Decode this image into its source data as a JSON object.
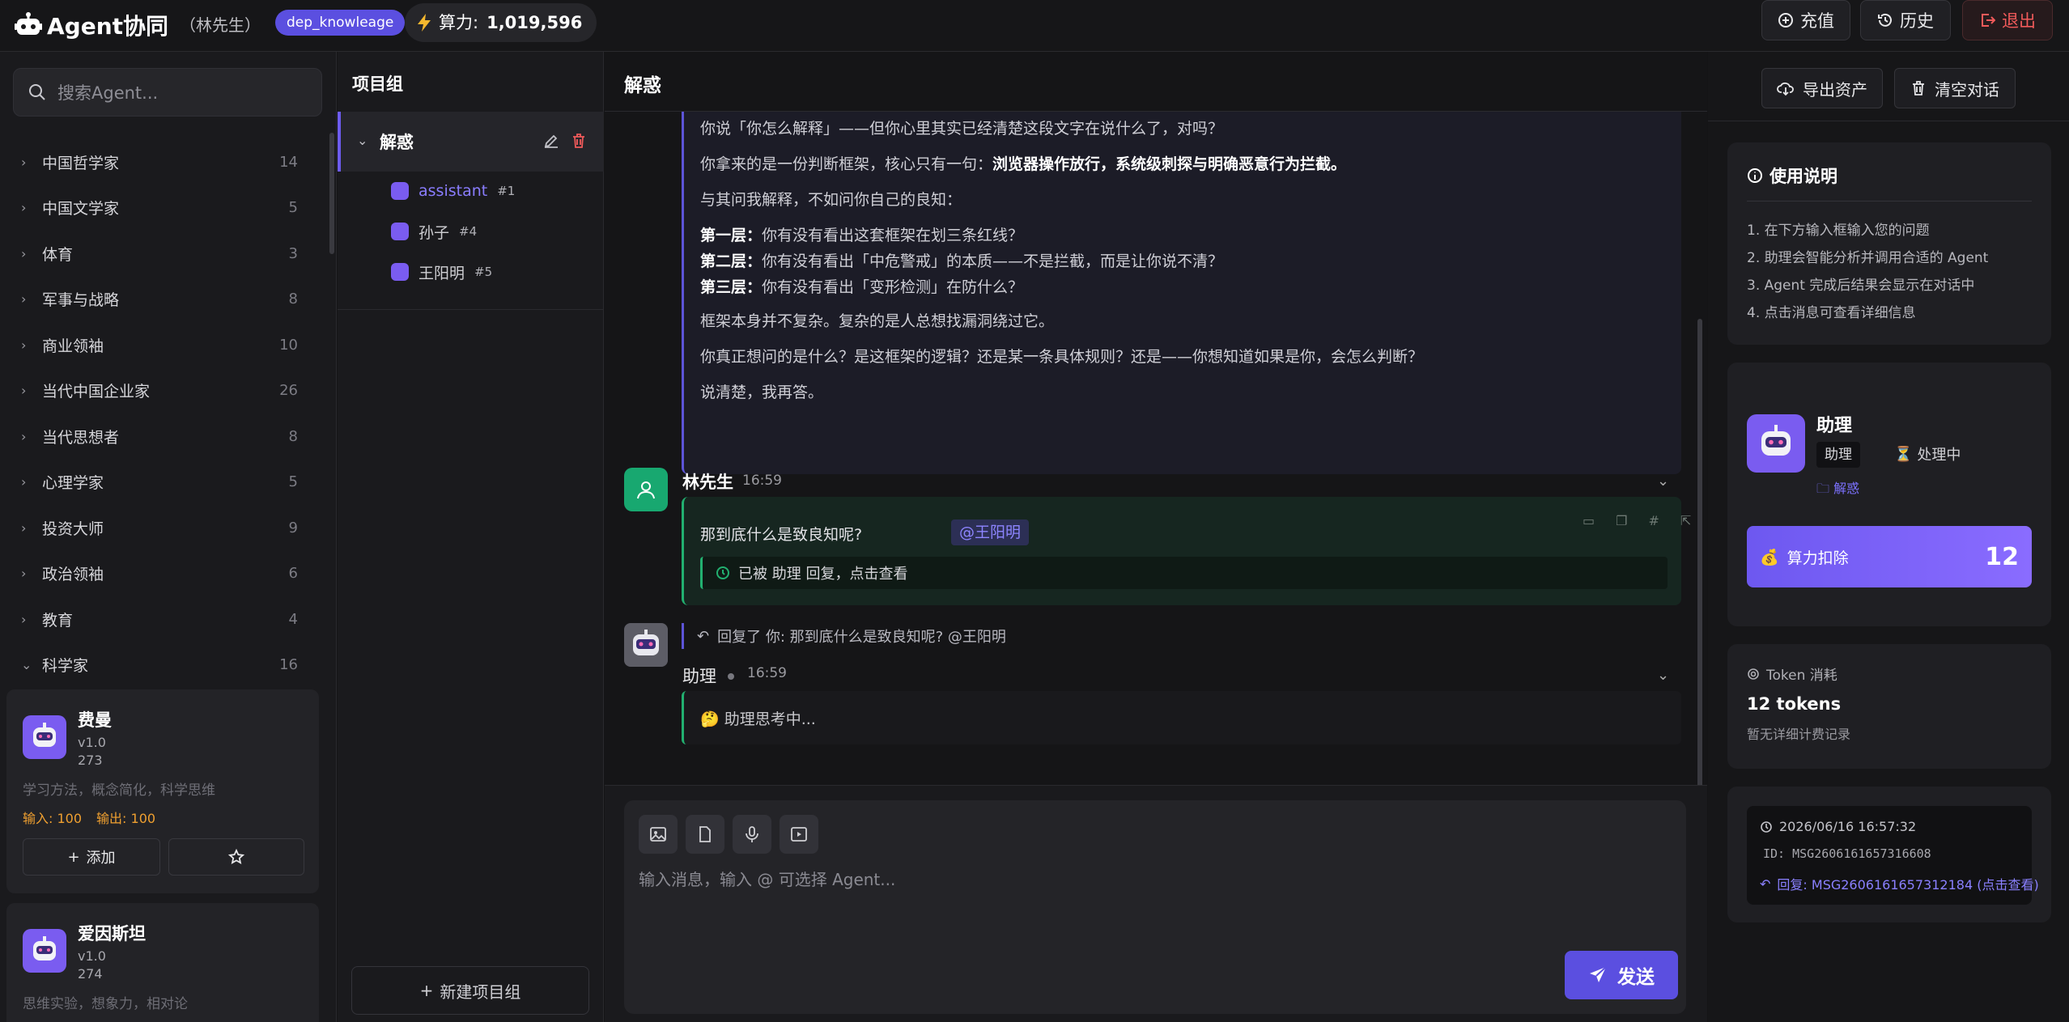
{
  "topbar": {
    "app_title": "Agent协同",
    "user": "（林先生）",
    "badge": "dep_knowleage",
    "power_label": "算力:",
    "power_value": "1,019,596",
    "recharge": "充值",
    "history": "历史",
    "logout": "退出"
  },
  "sidebar": {
    "search_placeholder": "搜索Agent...",
    "categories": [
      {
        "name": "中国哲学家",
        "count": "14"
      },
      {
        "name": "中国文学家",
        "count": "5"
      },
      {
        "name": "体育",
        "count": "3"
      },
      {
        "name": "军事与战略",
        "count": "8"
      },
      {
        "name": "商业领袖",
        "count": "10"
      },
      {
        "name": "当代中国企业家",
        "count": "26"
      },
      {
        "name": "当代思想者",
        "count": "8"
      },
      {
        "name": "心理学家",
        "count": "5"
      },
      {
        "name": "投资大师",
        "count": "9"
      },
      {
        "name": "政治领袖",
        "count": "6"
      },
      {
        "name": "教育",
        "count": "4"
      },
      {
        "name": "科学家",
        "count": "16"
      }
    ],
    "agents": [
      {
        "name": "费曼",
        "version": "v1.0",
        "id": "273",
        "desc": "学习方法，概念简化，科学思维",
        "input": "输入: 100",
        "output": "输出: 100",
        "add": "添加"
      },
      {
        "name": "爱因斯坦",
        "version": "v1.0",
        "id": "274",
        "desc": "思维实验，想象力，相对论"
      }
    ]
  },
  "projects": {
    "header": "项目组",
    "group": "解惑",
    "items": [
      {
        "name": "assistant",
        "tag": "#1"
      },
      {
        "name": "孙子",
        "tag": "#4"
      },
      {
        "name": "王阳明",
        "tag": "#5"
      }
    ],
    "new_group": "新建项目组"
  },
  "chat": {
    "title": "解惑",
    "ai_lines": {
      "l1": "你说「你怎么解释」——但你心里其实已经清楚这段文字在说什么了，对吗？",
      "l2_pre": "你拿来的是一份判断框架，核心只有一句：",
      "l2_bold": "浏览器操作放行，系统级刺探与明确恶意行为拦截。",
      "l3": "与其问我解释，不如问你自己的良知：",
      "l4_b": "第一层：",
      "l4": "你有没有看出这套框架在划三条红线？",
      "l5_b": "第二层：",
      "l5": "你有没有看出「中危警戒」的本质——不是拦截，而是让你说不清？",
      "l6_b": "第三层：",
      "l6": "你有没有看出「变形检测」在防什么？",
      "l7": "框架本身并不复杂。复杂的是人总想找漏洞绕过它。",
      "l8": "你真正想问的是什么？是这框架的逻辑？还是某一条具体规则？还是——你想知道如果是你，会怎么判断？",
      "l9": "说清楚，我再答。"
    },
    "user_name": "林先生",
    "user_time": "16:59",
    "user_text": "那到底什么是致良知呢?",
    "mention": "@王阳明",
    "replied_note": "已被 助理 回复，点击查看",
    "reply_to": "回复了 你: 那到底什么是致良知呢? @王阳明",
    "ai_name": "助理",
    "ai_time": "16:59",
    "thinking": "🤔 助理思考中...",
    "input_placeholder": "输入消息，输入 @ 可选择 Agent...",
    "send": "发送"
  },
  "right": {
    "export": "导出资产",
    "clear": "清空对话",
    "guide_title": "使用说明",
    "guide": [
      "1. 在下方输入框输入您的问题",
      "2. 助理会智能分析并调用合适的 Agent",
      "3. Agent 完成后结果会显示在对话中",
      "4. 点击消息可查看详细信息"
    ],
    "assistant_name": "助理",
    "assistant_tag": "助理",
    "assistant_status": "处理中",
    "assistant_project": "解惑",
    "cost_label": "算力扣除",
    "cost_value": "12",
    "token_title": "Token 消耗",
    "token_value": "12 tokens",
    "token_note": "暂无详细计费记录",
    "meta_time": "2026/06/16 16:57:32",
    "meta_id": "ID: MSG2606161657316608",
    "meta_reply": "回复: MSG2606161657312184 (点击查看)"
  },
  "colors": {
    "accent": "#5b4fe0",
    "user": "#22b070",
    "danger": "#f05a5a"
  }
}
